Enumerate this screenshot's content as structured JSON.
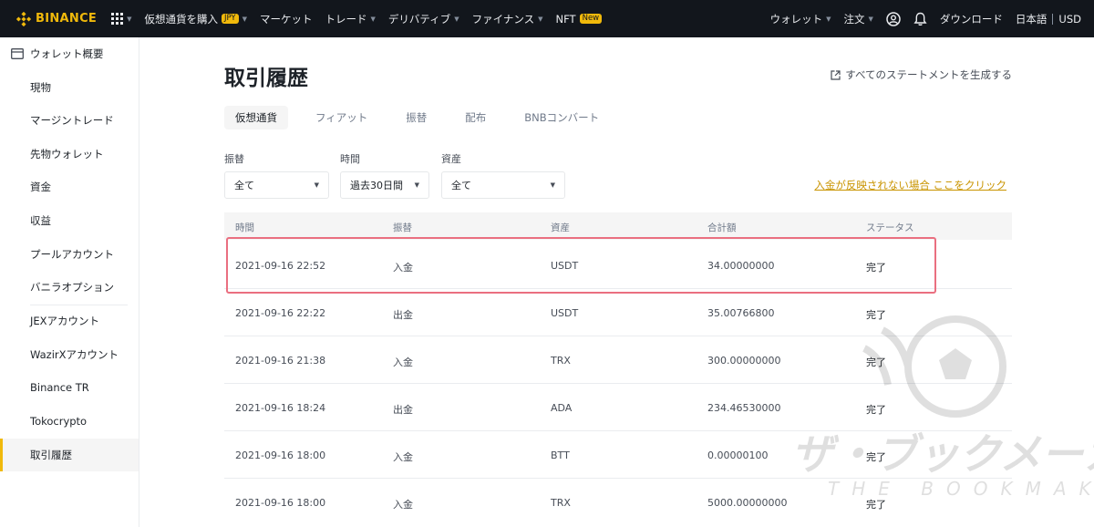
{
  "nav": {
    "logo": "BINANCE",
    "buy_crypto": "仮想通貨を購入",
    "buy_badge": "JPY",
    "markets": "マーケット",
    "trade": "トレード",
    "derivatives": "デリバティブ",
    "finance": "ファイナンス",
    "nft": "NFT",
    "nft_badge": "New",
    "wallet": "ウォレット",
    "orders": "注文",
    "download": "ダウンロード",
    "language": "日本語",
    "currency": "USD"
  },
  "sidebar": {
    "header": "ウォレット概要",
    "items": [
      {
        "label": "現物"
      },
      {
        "label": "マージントレード"
      },
      {
        "label": "先物ウォレット"
      },
      {
        "label": "資金"
      },
      {
        "label": "収益"
      },
      {
        "label": "プールアカウント"
      },
      {
        "label": "バニラオプション"
      },
      {
        "label": "JEXアカウント"
      },
      {
        "label": "WazirXアカウント"
      },
      {
        "label": "Binance TR"
      },
      {
        "label": "Tokocrypto"
      },
      {
        "label": "取引履歴"
      }
    ]
  },
  "main": {
    "title": "取引履歴",
    "statement_link": "すべてのステートメントを生成する",
    "tabs": [
      {
        "label": "仮想通貨"
      },
      {
        "label": "フィアット"
      },
      {
        "label": "振替"
      },
      {
        "label": "配布"
      },
      {
        "label": "BNBコンバート"
      }
    ],
    "filters": [
      {
        "label": "振替",
        "value": "全て"
      },
      {
        "label": "時間",
        "value": "過去30日間"
      },
      {
        "label": "資産",
        "value": "全て"
      }
    ],
    "help_link": "入金が反映されない場合 ここをクリック",
    "table": {
      "headers": [
        "時間",
        "振替",
        "資産",
        "合計額",
        "ステータス"
      ],
      "rows": [
        {
          "time": "2021-09-16 22:52",
          "type": "入金",
          "asset": "USDT",
          "amount": "34.00000000",
          "status": "完了"
        },
        {
          "time": "2021-09-16 22:22",
          "type": "出金",
          "asset": "USDT",
          "amount": "35.00766800",
          "status": "完了"
        },
        {
          "time": "2021-09-16 21:38",
          "type": "入金",
          "asset": "TRX",
          "amount": "300.00000000",
          "status": "完了"
        },
        {
          "time": "2021-09-16 18:24",
          "type": "出金",
          "asset": "ADA",
          "amount": "234.46530000",
          "status": "完了"
        },
        {
          "time": "2021-09-16 18:00",
          "type": "入金",
          "asset": "BTT",
          "amount": "0.00000100",
          "status": "完了"
        },
        {
          "time": "2021-09-16 18:00",
          "type": "入金",
          "asset": "TRX",
          "amount": "5000.00000000",
          "status": "完了"
        }
      ]
    }
  },
  "watermark": {
    "main": "ザ・ブックメーカーズ",
    "sub": "THE BOOKMAKERS"
  },
  "colors": {
    "brand": "#f0b90b",
    "nav_bg": "#12161c",
    "highlight_border": "#ea6f80",
    "link": "#c99400"
  }
}
